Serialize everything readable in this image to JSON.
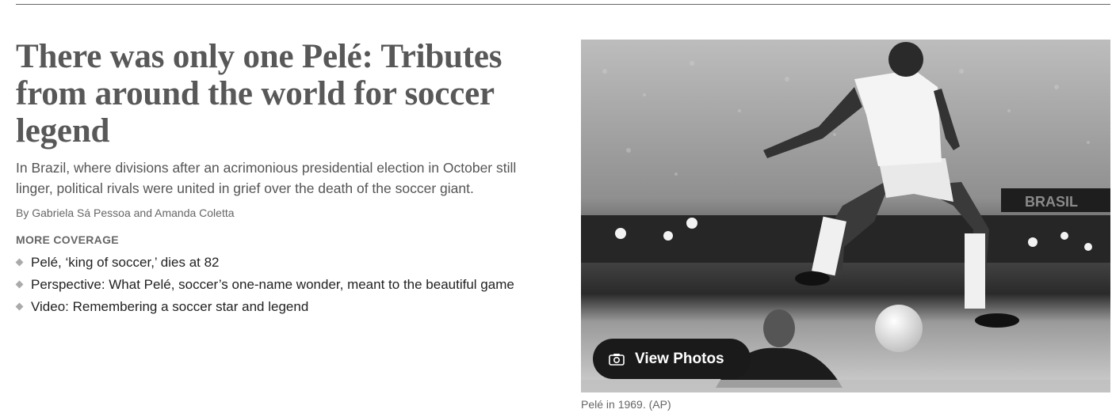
{
  "article": {
    "headline": "There was only one Pelé: Tributes from around the world for soccer legend",
    "dek": "In Brazil, where divisions after an acrimonious presidential election in October still linger, political rivals were united in grief over the death of the soccer giant.",
    "byline_prefix": "By ",
    "authors": "Gabriela Sá Pessoa and Amanda Coletta"
  },
  "more_coverage": {
    "label": "MORE COVERAGE",
    "items": [
      {
        "label": "Pelé, ‘king of soccer,’ dies at 82"
      },
      {
        "label": "Perspective: What Pelé, soccer’s one-name wonder, meant to the beautiful game"
      },
      {
        "label": "Video: Remembering a soccer star and legend"
      }
    ]
  },
  "media": {
    "view_photos_label": "View Photos",
    "view_photos_icon": "camera-icon",
    "caption": "Pelé in 1969. (AP)",
    "stadium_sign": "BRASIL"
  }
}
